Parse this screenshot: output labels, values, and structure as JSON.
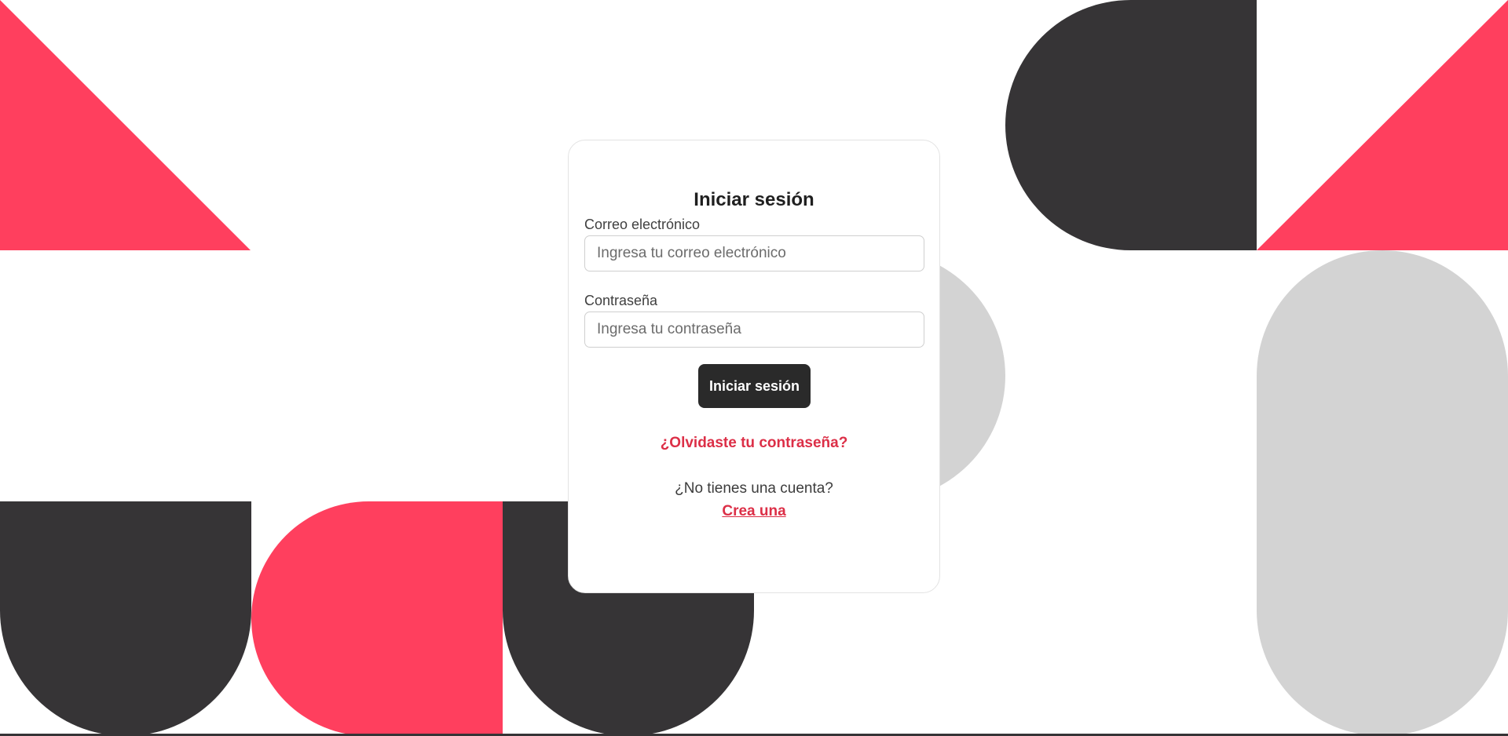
{
  "login": {
    "title": "Iniciar sesión",
    "email_label": "Correo electrónico",
    "email_placeholder": "Ingresa tu correo electrónico",
    "email_value": "",
    "password_label": "Contraseña",
    "password_placeholder": "Ingresa tu contraseña",
    "password_value": "",
    "submit_label": "Iniciar sesión",
    "forgot_password_link": "¿Olvidaste tu contraseña?",
    "no_account_text": "¿No tienes una cuenta?",
    "create_account_link": "Crea una"
  },
  "colors": {
    "accent_red": "#ff3f5e",
    "link_red": "#dc2f47",
    "dark": "#363436",
    "button_dark": "#2a2a2a",
    "light_grey": "#d3d3d3",
    "background": "#ffffff"
  }
}
